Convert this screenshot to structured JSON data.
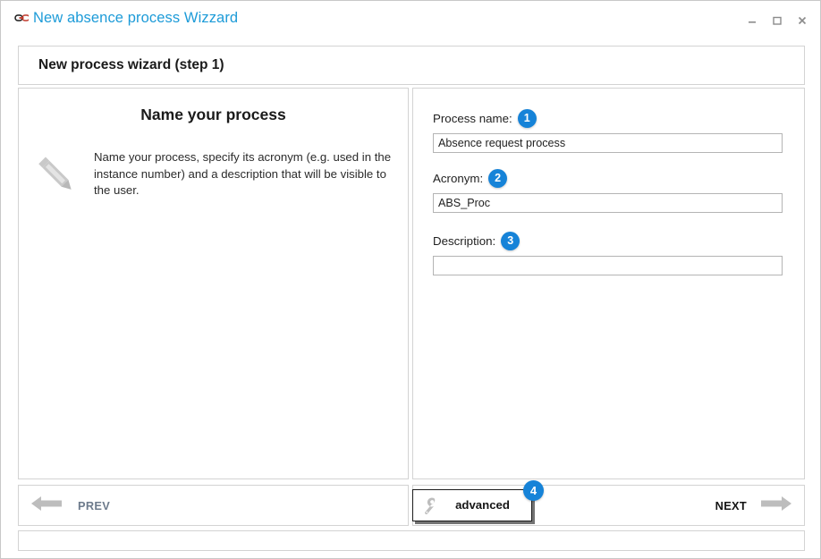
{
  "window": {
    "title": "New absence process Wizzard",
    "app_icon": "link-chain-icon",
    "controls": {
      "minimize": "minimize-icon",
      "maximize": "maximize-icon",
      "close": "close-icon"
    }
  },
  "header": {
    "title": "New process wizard (step 1)"
  },
  "left_panel": {
    "heading": "Name your process",
    "icon": "pencil-icon",
    "description": "Name your process, specify its acronym (e.g. used in the instance number) and a description that will be visible to the user."
  },
  "form": {
    "fields": [
      {
        "label": "Process name:",
        "badge": "1",
        "value": "Absence request process",
        "placeholder": ""
      },
      {
        "label": "Acronym:",
        "badge": "2",
        "value": "ABS_Proc",
        "placeholder": ""
      },
      {
        "label": "Description:",
        "badge": "3",
        "value": "",
        "placeholder": ""
      }
    ]
  },
  "footer": {
    "prev_label": "PREV",
    "prev_icon": "arrow-left-icon",
    "advanced_label": "advanced",
    "advanced_icon": "wrench-icon",
    "advanced_badge": "4",
    "next_label": "NEXT",
    "next_icon": "arrow-right-icon"
  },
  "colors": {
    "title_blue": "#1d9bd8",
    "badge_blue": "#1683d8",
    "panel_border": "#d3d3d3",
    "icon_gray": "#c0c0c0",
    "prev_text": "#6d7b8c"
  }
}
